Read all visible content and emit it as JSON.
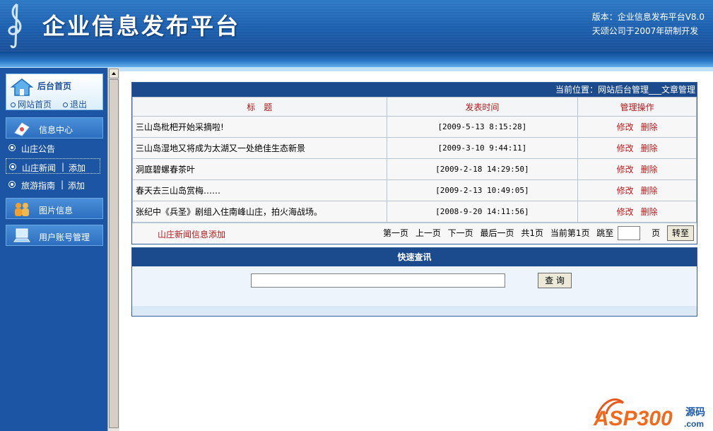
{
  "header": {
    "title": "企业信息发布平台",
    "version_line": "版本：企业信息发布平台V8.0",
    "company_line": "天颂公司于2007年研制开发"
  },
  "sidebar": {
    "home": {
      "label": "后台首页",
      "site_link": "网站首页",
      "logout_link": "退出"
    },
    "info_center": {
      "label": "信息中心"
    },
    "sub_items": [
      {
        "label": "山庄公告",
        "add": ""
      },
      {
        "label": "山庄新闻",
        "add": "添加"
      },
      {
        "label": "旅游指南",
        "add": "添加"
      }
    ],
    "separator": "|",
    "image_info": {
      "label": "图片信息"
    },
    "user_admin": {
      "label": "用户账号管理"
    }
  },
  "main": {
    "breadcrumb": "当前位置：网站后台管理___文章管理",
    "columns": [
      "标　题",
      "发表时间",
      "管理操作"
    ],
    "rows": [
      {
        "title": "三山岛枇杷开始采摘啦!",
        "time": "[2009-5-13 8:15:28]"
      },
      {
        "title": "三山岛湿地又将成为太湖又一处绝佳生态新景",
        "time": "[2009-3-10 9:44:11]"
      },
      {
        "title": "洞庭碧螺春茶叶",
        "time": "[2009-2-18 14:29:50]"
      },
      {
        "title": "春天去三山岛赏梅……",
        "time": "[2009-2-13 10:49:05]"
      },
      {
        "title": "张纪中《兵圣》剧组入住南峰山庄，拍火海战场。",
        "time": "[2008-9-20 14:11:56]"
      }
    ],
    "op_edit": "修改",
    "op_delete": "删除",
    "add_link": "山庄新闻信息添加",
    "pager": {
      "first": "第一页",
      "prev": "上一页",
      "next": "下一页",
      "last": "最后一页",
      "total": "共1页",
      "current": "当前第1页",
      "jump": "跳至",
      "page_unit": "页",
      "go": "转至"
    }
  },
  "search": {
    "title": "快速查讯",
    "button": "查 询",
    "value": ""
  },
  "watermark": {
    "brand": "ASP300",
    "suffix": "源码",
    "domain": ".com"
  },
  "colors": {
    "header_blue": "#1b5fae",
    "sidebar_blue": "#1c55a4",
    "link_red": "#c01818",
    "table_head": "#1b4b8c"
  }
}
